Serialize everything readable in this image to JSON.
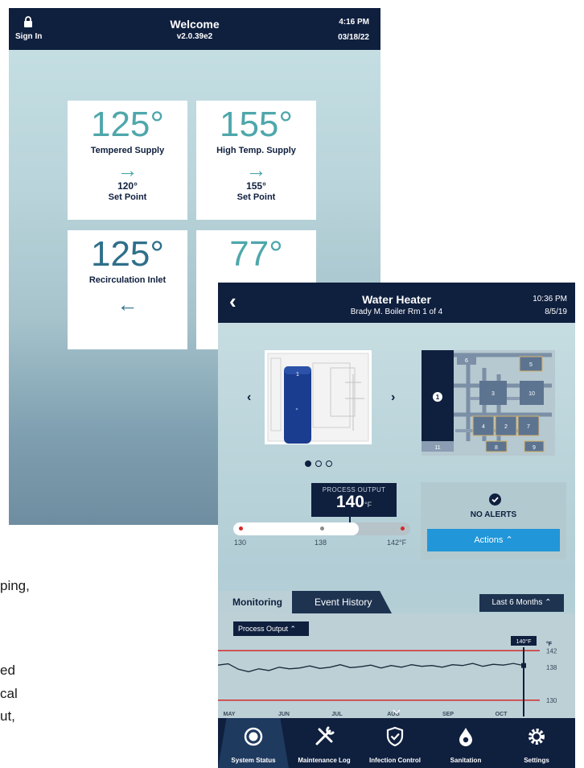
{
  "welcome": {
    "sign_in": "Sign In",
    "title": "Welcome",
    "version": "v2.0.39e2",
    "time": "4:16 PM",
    "date": "03/18/22",
    "tiles": [
      {
        "temp": "125°",
        "label": "Tempered Supply",
        "arrow": "→",
        "setpoint": "120°",
        "setpoint_label": "Set Point"
      },
      {
        "temp": "155°",
        "label": "High Temp. Supply",
        "arrow": "→",
        "setpoint": "155°",
        "setpoint_label": "Set Point"
      },
      {
        "temp": "125°",
        "label": "Recirculation Inlet",
        "arrow": "←"
      },
      {
        "temp": "77°"
      }
    ]
  },
  "background_text": [
    "ping,",
    "ed",
    "cal",
    "ut,"
  ],
  "heater": {
    "title": "Water Heater",
    "subtitle": "Brady M. Boiler Rm 1 of 4",
    "time": "10:36 PM",
    "date": "8/5/19",
    "plan_units": [
      "1",
      "2",
      "3",
      "4",
      "5",
      "6",
      "7",
      "8",
      "9",
      "10",
      "11"
    ],
    "process_output_label": "PROCESS OUTPUT",
    "process_output_value": "140",
    "process_output_unit": "°F",
    "process_output_fraction": 0.71,
    "scale": {
      "min": "130",
      "mid": "138",
      "max": "142°F"
    },
    "alerts_label": "NO ALERTS",
    "actions_label": "Actions ⌃",
    "tabs": {
      "monitoring": "Monitoring",
      "event_history": "Event History"
    },
    "range_select": "Last 6 Months ⌃",
    "metric_select": "Process Output ⌃",
    "chart_data": {
      "type": "line",
      "x": [
        "MAY",
        "JUN",
        "JUL",
        "AUG",
        "SEP",
        "OCT"
      ],
      "unit": "°F",
      "y_ticks": [
        142,
        138,
        130
      ],
      "ylim": [
        128,
        144
      ],
      "limits": {
        "upper": 142,
        "lower": 130
      },
      "cursor_label": "140°F",
      "series": [
        {
          "values": [
            138.5,
            138.8,
            137.5,
            136.9,
            137.6,
            137.2,
            138.0,
            137.6,
            137.8,
            138.3,
            137.7,
            138.0,
            138.6,
            137.9,
            138.1,
            138.5,
            137.8,
            138.4,
            138.0,
            138.6,
            138.2,
            138.4,
            138.0,
            138.6,
            138.4,
            138.9,
            138.2,
            138.7,
            138.5,
            138.9,
            138.4
          ]
        }
      ]
    },
    "nav": [
      {
        "label": "System Status",
        "icon": "target-icon"
      },
      {
        "label": "Maintenance Log",
        "icon": "wrench-icon"
      },
      {
        "label": "Infection Control",
        "icon": "shield-check-icon"
      },
      {
        "label": "Sanitation",
        "icon": "drop-icon"
      },
      {
        "label": "Settings",
        "icon": "gear-icon"
      }
    ]
  }
}
